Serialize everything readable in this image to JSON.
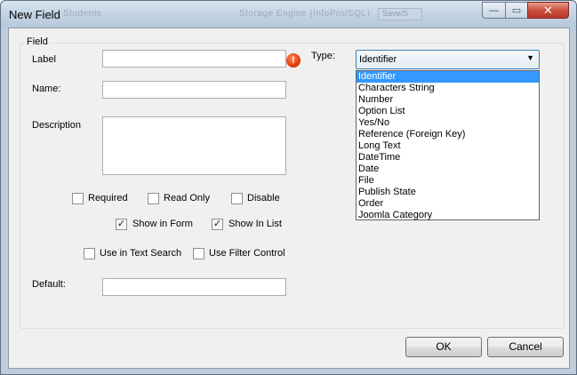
{
  "window": {
    "title": "New Field",
    "ghost_texts": [
      "Students",
      "Storage Engine (InfoPro/SQL)",
      "Save/S"
    ],
    "close_glyph": "✕",
    "min_glyph": "—",
    "max_glyph": "▭"
  },
  "group": {
    "label": "Field"
  },
  "fields": {
    "label": {
      "label": "Label",
      "value": ""
    },
    "name": {
      "label": "Name:",
      "value": ""
    },
    "description": {
      "label": "Description",
      "value": ""
    },
    "default": {
      "label": "Default:",
      "value": ""
    },
    "alert_glyph": "!"
  },
  "checkboxes": [
    {
      "label": "Required",
      "checked": false
    },
    {
      "label": "Read Only",
      "checked": false
    },
    {
      "label": "Disable",
      "checked": false
    },
    {
      "label": "Show in Form",
      "checked": true
    },
    {
      "label": "Show In List",
      "checked": true
    },
    {
      "label": "Use in Text Search",
      "checked": false
    },
    {
      "label": "Use Filter Control",
      "checked": false
    }
  ],
  "check_glyph": "✓",
  "type": {
    "label": "Type:",
    "selected": "Identifier",
    "arrow": "▼",
    "options": [
      "Identifier",
      "Characters String",
      "Number",
      "Option List",
      "Yes/No",
      "Reference (Foreign Key)",
      "Long Text",
      "DateTime",
      "Date",
      "File",
      "Publish State",
      "Order",
      "Joomla Category"
    ]
  },
  "buttons": {
    "ok": "OK",
    "cancel": "Cancel"
  },
  "colors": {
    "selection": "#3399ff",
    "title_bar": "#c2d2e2",
    "close_button": "#c94a3a"
  }
}
